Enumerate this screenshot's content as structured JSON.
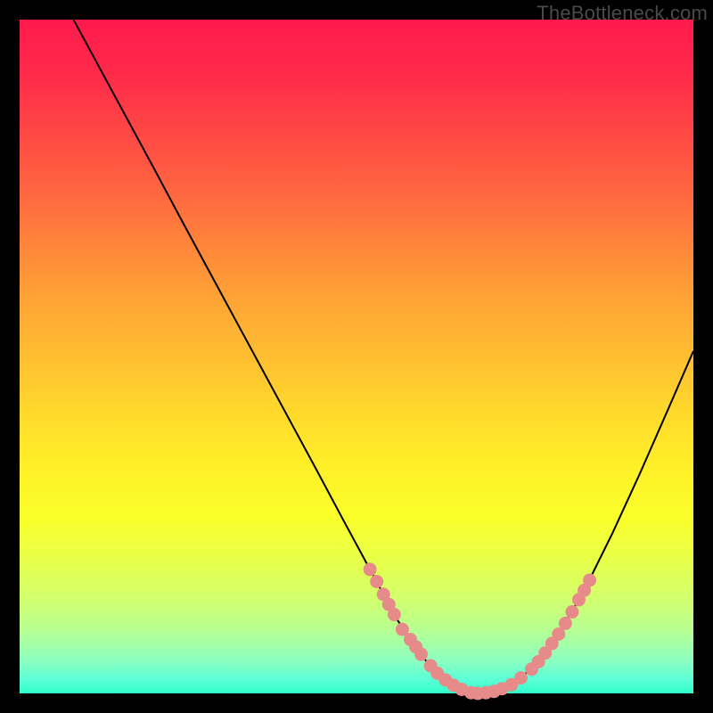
{
  "watermark": "TheBottleneck.com",
  "colors": {
    "page_bg": "#000000",
    "gradient_top": "#ff1a4d",
    "gradient_bottom": "#2fffc9",
    "curve": "#000000",
    "marker": "#e78a8a"
  },
  "chart_data": {
    "type": "line",
    "title": "",
    "xlabel": "",
    "ylabel": "",
    "xlim": [
      0,
      100
    ],
    "ylim": [
      0,
      100
    ],
    "grid": false,
    "legend": false,
    "annotations": [],
    "series": [
      {
        "name": "curve",
        "x": [
          8,
          12,
          16,
          20,
          24,
          28,
          32,
          36,
          40,
          44,
          48,
          52,
          54,
          56,
          58,
          60,
          62,
          64,
          66,
          68,
          72,
          76,
          80,
          84,
          88,
          92,
          96,
          100
        ],
        "y": [
          100,
          92.6,
          85.2,
          77.8,
          70.3,
          62.9,
          55.5,
          48.1,
          40.7,
          33.3,
          25.8,
          18.4,
          14.7,
          11.0,
          8.0,
          5.2,
          3.0,
          1.4,
          0.4,
          0.0,
          0.8,
          3.6,
          8.8,
          15.7,
          23.8,
          32.5,
          41.6,
          50.8
        ]
      }
    ],
    "markers": [
      {
        "x": 52.0,
        "y": 18.4
      },
      {
        "x": 53.0,
        "y": 16.6
      },
      {
        "x": 54.0,
        "y": 14.7
      },
      {
        "x": 54.8,
        "y": 13.2
      },
      {
        "x": 55.6,
        "y": 11.7
      },
      {
        "x": 56.8,
        "y": 9.5
      },
      {
        "x": 58.0,
        "y": 8.0
      },
      {
        "x": 58.8,
        "y": 6.9
      },
      {
        "x": 59.6,
        "y": 5.8
      },
      {
        "x": 61.0,
        "y": 4.1
      },
      {
        "x": 62.0,
        "y": 3.0
      },
      {
        "x": 63.2,
        "y": 2.0
      },
      {
        "x": 64.4,
        "y": 1.2
      },
      {
        "x": 65.6,
        "y": 0.6
      },
      {
        "x": 67.0,
        "y": 0.1
      },
      {
        "x": 68.0,
        "y": 0.0
      },
      {
        "x": 69.2,
        "y": 0.1
      },
      {
        "x": 70.4,
        "y": 0.3
      },
      {
        "x": 71.6,
        "y": 0.7
      },
      {
        "x": 73.0,
        "y": 1.3
      },
      {
        "x": 74.4,
        "y": 2.3
      },
      {
        "x": 76.0,
        "y": 3.6
      },
      {
        "x": 77.0,
        "y": 4.7
      },
      {
        "x": 78.0,
        "y": 6.0
      },
      {
        "x": 79.0,
        "y": 7.4
      },
      {
        "x": 80.0,
        "y": 8.8
      },
      {
        "x": 81.0,
        "y": 10.4
      },
      {
        "x": 82.0,
        "y": 12.1
      },
      {
        "x": 83.0,
        "y": 13.9
      },
      {
        "x": 83.8,
        "y": 15.3
      },
      {
        "x": 84.6,
        "y": 16.8
      }
    ]
  }
}
